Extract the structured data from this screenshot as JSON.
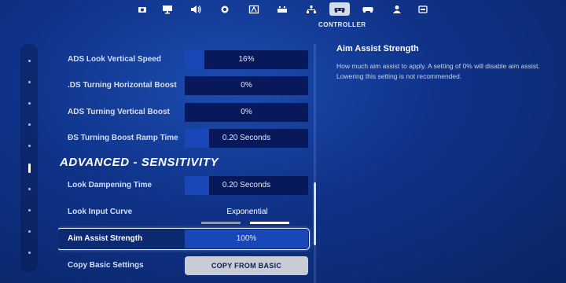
{
  "tabs": [
    {
      "icon": "camera-icon",
      "active": false
    },
    {
      "icon": "monitor-icon",
      "active": false
    },
    {
      "icon": "speaker-icon",
      "active": false
    },
    {
      "icon": "gear-icon",
      "active": false
    },
    {
      "icon": "accessibility-icon",
      "active": false
    },
    {
      "icon": "keyboard-icon",
      "active": false
    },
    {
      "icon": "network-icon",
      "active": false
    },
    {
      "icon": "controller-icon",
      "active": true
    },
    {
      "icon": "gamepad-icon",
      "active": false
    },
    {
      "icon": "account-icon",
      "active": false
    },
    {
      "icon": "data-icon",
      "active": false
    }
  ],
  "active_tab_label": "CONTROLLER",
  "settings": {
    "rows": [
      {
        "label": "ADS Look Vertical Speed",
        "value": "16%",
        "fill": 0.16
      },
      {
        "label": ".DS Turning Horizontal Boost",
        "value": "0%",
        "fill": 0.0
      },
      {
        "label": "ADS Turning Vertical Boost",
        "value": "0%",
        "fill": 0.0
      },
      {
        "label": "ÐS Turning Boost Ramp Time",
        "value": "0.20 Seconds",
        "fill": 0.2
      }
    ],
    "section_title": "ADVANCED - SENSITIVITY",
    "look_dampening": {
      "label": "Look Dampening Time",
      "value": "0.20 Seconds",
      "fill": 0.2
    },
    "look_curve": {
      "label": "Look Input Curve",
      "value": "Exponential",
      "options": 2,
      "selected_index": 1
    },
    "aim_assist": {
      "label": "Aim Assist Strength",
      "value": "100%",
      "fill": 1.0
    },
    "copy_basic": {
      "label": "Copy Basic Settings",
      "button": "COPY FROM BASIC"
    }
  },
  "description": {
    "title": "Aim Assist Strength",
    "text": "How much aim assist to apply.  A setting of 0% will disable aim assist.  Lowering this setting is not recommended."
  },
  "colors": {
    "accent": "#1a47b8",
    "value_bg": "#07195a",
    "background": "#0f3288"
  }
}
